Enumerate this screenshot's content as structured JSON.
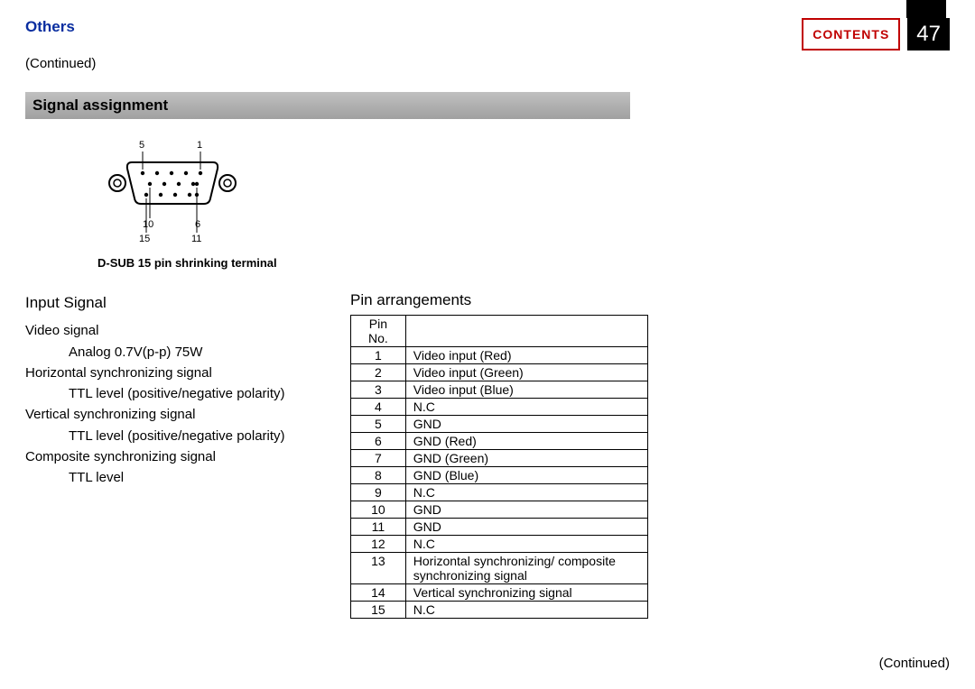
{
  "header": {
    "section": "Others",
    "contents_label": "CONTENTS",
    "page_number": "47",
    "continued": "(Continued)"
  },
  "title": "Signal assignment",
  "diagram": {
    "label_5": "5",
    "label_1": "1",
    "label_10": "10",
    "label_6": "6",
    "label_15": "15",
    "label_11": "11",
    "caption": "D-SUB 15 pin shrinking terminal"
  },
  "input_signal": {
    "heading": "Input Signal",
    "lines": [
      {
        "text": "Video signal",
        "indent": 1
      },
      {
        "text": "Analog 0.7V(p-p)   75W",
        "indent": 2
      },
      {
        "text": "Horizontal synchronizing signal",
        "indent": 1
      },
      {
        "text": "TTL level (positive/negative polarity)",
        "indent": 2
      },
      {
        "text": "Vertical synchronizing signal",
        "indent": 1
      },
      {
        "text": "TTL level  (positive/negative polarity)",
        "indent": 2
      },
      {
        "text": "Composite synchronizing signal",
        "indent": 1
      },
      {
        "text": "TTL level",
        "indent": 2
      }
    ]
  },
  "pin_arrangements": {
    "heading": "Pin arrangements",
    "header_row": {
      "col1": "Pin No.",
      "col2": ""
    },
    "rows": [
      {
        "no": "1",
        "desc": "Video input (Red)"
      },
      {
        "no": "2",
        "desc": "Video input (Green)"
      },
      {
        "no": "3",
        "desc": "Video input (Blue)"
      },
      {
        "no": "4",
        "desc": "N.C"
      },
      {
        "no": "5",
        "desc": "GND"
      },
      {
        "no": "6",
        "desc": "GND (Red)"
      },
      {
        "no": "7",
        "desc": "GND (Green)"
      },
      {
        "no": "8",
        "desc": "GND (Blue)"
      },
      {
        "no": "9",
        "desc": "N.C"
      },
      {
        "no": "10",
        "desc": "GND"
      },
      {
        "no": "11",
        "desc": "GND"
      },
      {
        "no": "12",
        "desc": "N.C"
      },
      {
        "no": "13",
        "desc": "Horizontal synchronizing/ composite synchronizing signal"
      },
      {
        "no": "14",
        "desc": "Vertical synchronizing signal"
      },
      {
        "no": "15",
        "desc": "N.C"
      }
    ]
  },
  "footer": {
    "continued": "(Continued)"
  }
}
